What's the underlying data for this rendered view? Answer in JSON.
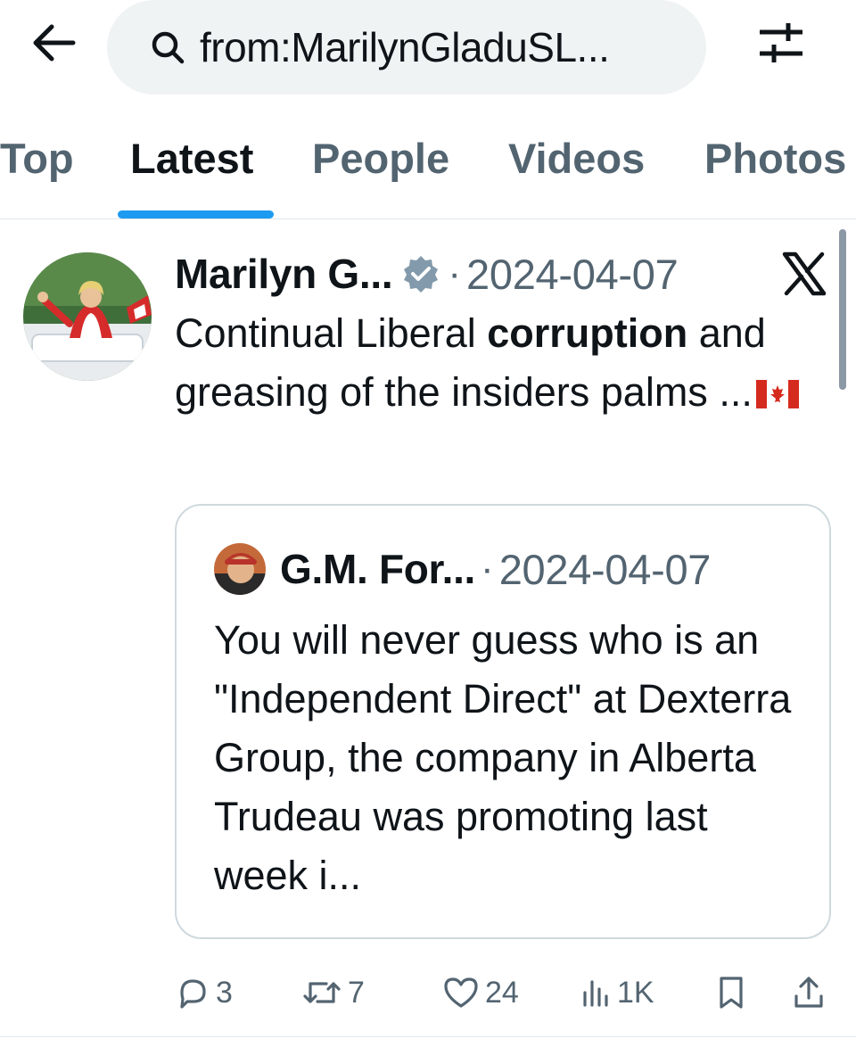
{
  "search": {
    "query": "from:MarilynGladuSL..."
  },
  "tabs": [
    {
      "label": "Top"
    },
    {
      "label": "Latest"
    },
    {
      "label": "People"
    },
    {
      "label": "Videos"
    },
    {
      "label": "Photos"
    }
  ],
  "active_tab": "Latest",
  "tweet": {
    "author_name": "Marilyn G...",
    "verified": true,
    "separator": "·",
    "date": "2024-04-07",
    "text_before": "Continual Liberal ",
    "text_keyword": "corruption",
    "text_after": " and greasing of the insiders palms ...",
    "flag_icon": "canada-flag-icon",
    "quote": {
      "author_name": "G.M. For...",
      "separator": "·",
      "date": "2024-04-07",
      "text": "You will never guess who is an \"Independent Direct\" at Dexterra Group, the company in Alberta Trudeau was promoting last week i..."
    },
    "actions": {
      "replies": "3",
      "retweets": "7",
      "likes": "24",
      "views": "1K"
    }
  },
  "colors": {
    "accent": "#1d9bf0",
    "muted_text": "#536471",
    "verified_badge": "#829aab",
    "border": "#cfd9de"
  }
}
